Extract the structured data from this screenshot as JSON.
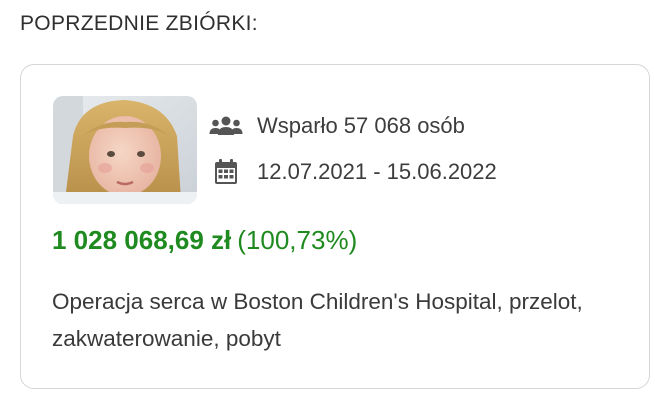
{
  "section": {
    "title": "POPRZEDNIE ZBIÓRKI:"
  },
  "fundraiser": {
    "supporters_text": "Wsparło 57 068 osób",
    "date_range": "12.07.2021 - 15.06.2022",
    "amount": "1 028 068,69 zł",
    "percent": "(100,73%)",
    "description": "Operacja serca w Boston Children's Hospital, przelot, zakwaterowanie, pobyt",
    "icons": {
      "supporters": "users-icon",
      "dates": "calendar-icon"
    },
    "thumbnail": "child-photo",
    "colors": {
      "amount": "#1f8a1f",
      "icon": "#555555"
    }
  }
}
